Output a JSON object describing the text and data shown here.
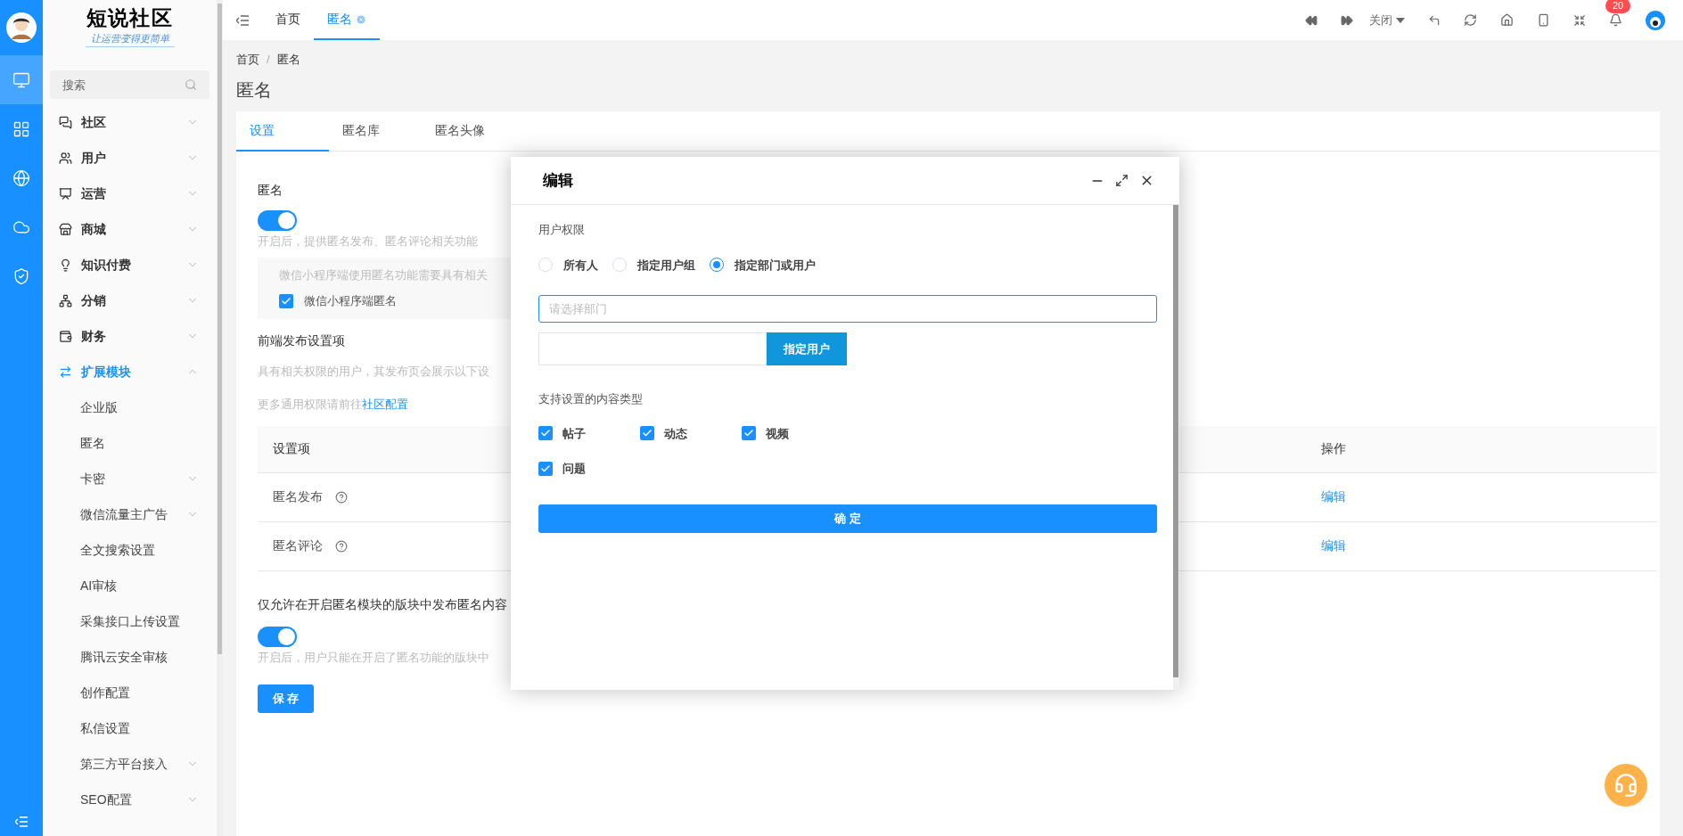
{
  "rail": {
    "items": [
      {
        "selected": true
      },
      {
        "selected": false
      },
      {
        "selected": false
      },
      {
        "selected": false
      },
      {
        "selected": false
      }
    ]
  },
  "brand": {
    "title": "短说社区",
    "slogan": "让运营变得更简单"
  },
  "sidebar": {
    "search_placeholder": "搜索",
    "items": [
      {
        "label": "社区",
        "expanded": false,
        "selected": false
      },
      {
        "label": "用户",
        "expanded": false,
        "selected": false
      },
      {
        "label": "运营",
        "expanded": false,
        "selected": false
      },
      {
        "label": "商城",
        "expanded": false,
        "selected": false
      },
      {
        "label": "知识付费",
        "expanded": false,
        "selected": false
      },
      {
        "label": "分销",
        "expanded": false,
        "selected": false
      },
      {
        "label": "财务",
        "expanded": false,
        "selected": false
      },
      {
        "label": "扩展模块",
        "expanded": true,
        "selected": true,
        "children": [
          {
            "label": "企业版",
            "kind": "link"
          },
          {
            "label": "匿名",
            "kind": "link"
          },
          {
            "label": "卡密",
            "kind": "group",
            "expanded": false
          },
          {
            "label": "微信流量主广告",
            "kind": "group",
            "expanded": false
          },
          {
            "label": "全文搜索设置",
            "kind": "link"
          },
          {
            "label": "AI审核",
            "kind": "link"
          },
          {
            "label": "采集接口上传设置",
            "kind": "link"
          },
          {
            "label": "腾讯云安全审核",
            "kind": "link"
          },
          {
            "label": "创作配置",
            "kind": "link"
          },
          {
            "label": "私信设置",
            "kind": "link"
          },
          {
            "label": "第三方平台接入",
            "kind": "group",
            "expanded": false
          },
          {
            "label": "SEO配置",
            "kind": "group",
            "expanded": false
          }
        ]
      }
    ]
  },
  "top_tabs": [
    {
      "label": "首页",
      "selected": false
    },
    {
      "label": "匿名",
      "selected": true
    }
  ],
  "toolbar": {
    "close_menu": "关闭",
    "notifications_badge": "20"
  },
  "breadcrumb": {
    "home": "首页",
    "separator": "/",
    "current": "匿名"
  },
  "page_title": "匿名",
  "tabs": [
    {
      "label": "设置",
      "selected": true
    },
    {
      "label": "匿名库",
      "selected": false
    },
    {
      "label": "匿名头像",
      "selected": false
    }
  ],
  "anonymous": {
    "label": "匿名",
    "on": true,
    "hint": "开启后，提供匿名发布、匿名评论相关功能",
    "notice": "微信小程序端使用匿名功能需要具有相关",
    "mini_program": {
      "label": "微信小程序端匿名",
      "checked": true
    }
  },
  "frontend": {
    "title": "前端发布设置项",
    "hint": "具有相关权限的用户，其发布页会展示以下设",
    "more_prefix": "更多通用权限请前往",
    "more_link": "社区配置"
  },
  "table": {
    "columns": [
      "设置项",
      "操作"
    ],
    "rows": [
      {
        "name": "匿名发布",
        "action": "编辑"
      },
      {
        "name": "匿名评论",
        "action": "编辑"
      }
    ]
  },
  "restrict": {
    "label": "仅允许在开启匿名模块的版块中发布匿名内容",
    "on": true,
    "hint": "开启后，用户只能在开启了匿名功能的版块中"
  },
  "save_button": "保 存",
  "dialog": {
    "title": "编辑",
    "permission_label": "用户权限",
    "radios": [
      {
        "label": "所有人",
        "selected": false
      },
      {
        "label": "指定用户组",
        "selected": false
      },
      {
        "label": "指定部门或用户",
        "selected": true
      }
    ],
    "department_placeholder": "请选择部门",
    "user_button": "指定用户",
    "types_label": "支持设置的内容类型",
    "types": [
      {
        "label": "帖子",
        "checked": true
      },
      {
        "label": "动态",
        "checked": true
      },
      {
        "label": "视频",
        "checked": true
      },
      {
        "label": "问题",
        "checked": true
      }
    ],
    "confirm": "确 定"
  }
}
